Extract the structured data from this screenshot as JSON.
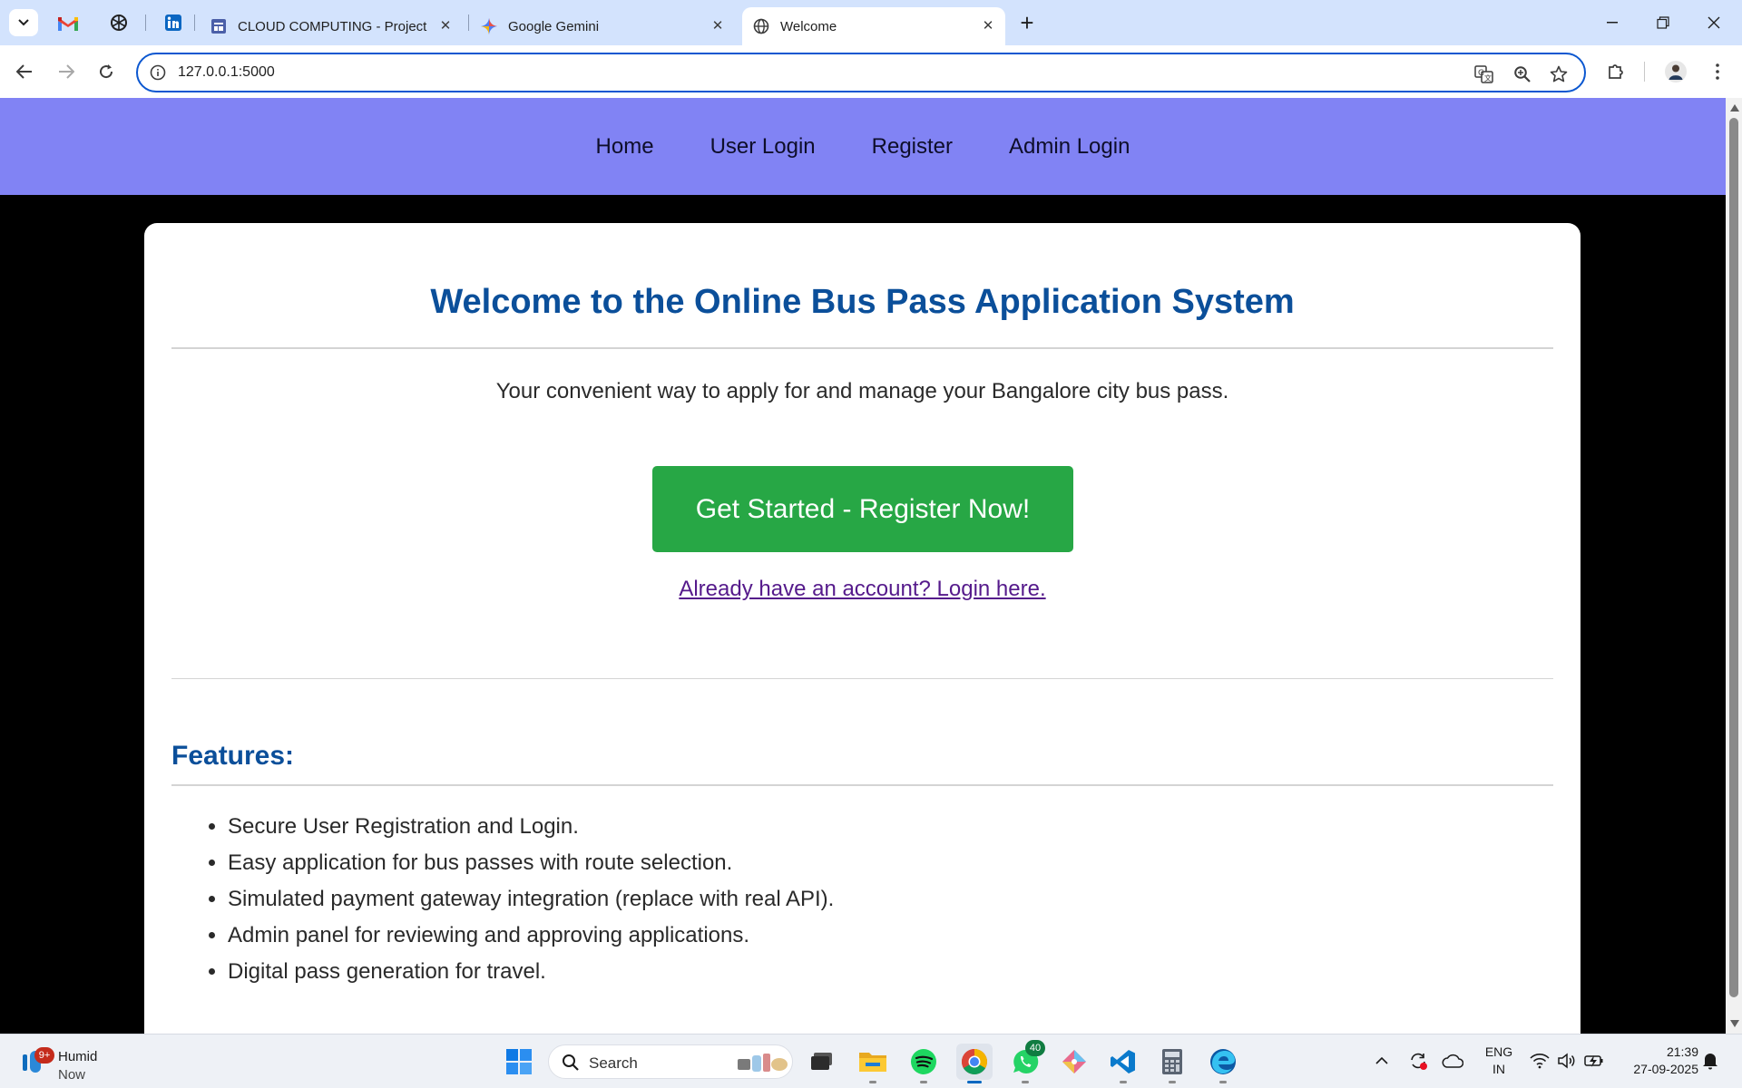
{
  "browser": {
    "tabs": [
      {
        "title": "CLOUD COMPUTING - Project",
        "favicon": "forms-icon"
      },
      {
        "title": "Google Gemini",
        "favicon": "gemini-icon"
      },
      {
        "title": "Welcome",
        "favicon": "globe-icon",
        "active": true
      }
    ],
    "pinned_tabs": [
      "gmail-icon",
      "chatgpt-icon",
      "linkedin-icon"
    ],
    "url": "127.0.0.1:5000"
  },
  "site": {
    "nav": [
      "Home",
      "User Login",
      "Register",
      "Admin Login"
    ],
    "title": "Welcome to the Online Bus Pass Application System",
    "tagline": "Your convenient way to apply for and manage your Bangalore city bus pass.",
    "cta": "Get Started - Register Now!",
    "login_link": "Already have an account? Login here.",
    "features_title": "Features:",
    "features": [
      "Secure User Registration and Login.",
      "Easy application for bus passes with route selection.",
      "Simulated payment gateway integration (replace with real API).",
      "Admin panel for reviewing and approving applications.",
      "Digital pass generation for travel."
    ],
    "colors": {
      "nav_bg": "#8183f4",
      "heading": "#0b4f9a",
      "cta": "#27a745",
      "link_visited": "#551a8b"
    }
  },
  "taskbar": {
    "weather": {
      "label": "Humid",
      "time": "Now",
      "badge": "9+"
    },
    "search_placeholder": "Search",
    "whatsapp_badge": "40",
    "lang": [
      "ENG",
      "IN"
    ],
    "time": "21:39",
    "date": "27-09-2025"
  }
}
